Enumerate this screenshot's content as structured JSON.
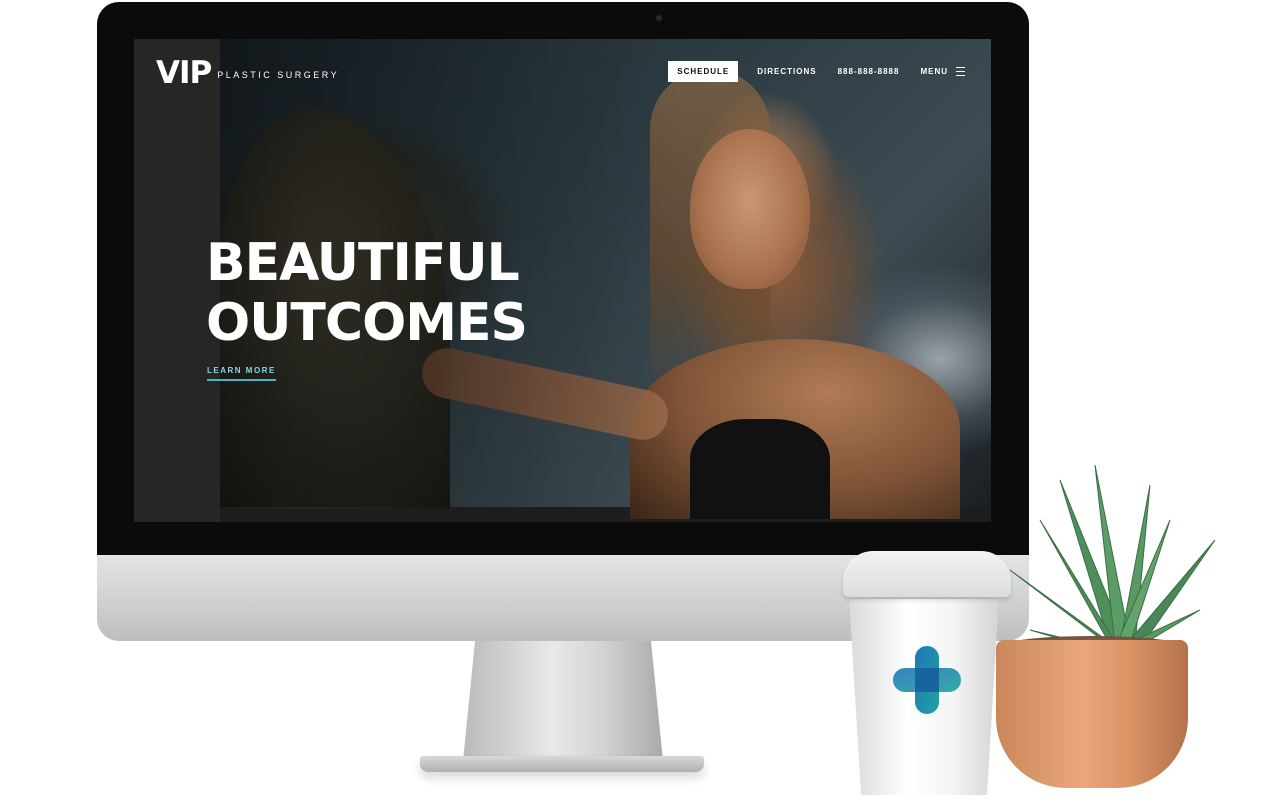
{
  "site": {
    "logo": {
      "mark": "VIP",
      "tagline": "PLASTIC SURGERY"
    },
    "nav": {
      "schedule_label": "SCHEDULE",
      "directions_label": "DIRECTIONS",
      "phone": "888-888-8888",
      "menu_label": "MENU"
    },
    "hero": {
      "headline_line1": "BEAUTIFUL",
      "headline_line2": "OUTCOMES",
      "cta_label": "LEARN MORE"
    }
  },
  "colors": {
    "accent": "#4fb3c8",
    "brand_blue": "#1f76b5",
    "brand_teal": "#1fa3a3",
    "pot": "#e59e70",
    "plant_green": "#4f8f5a"
  },
  "icons": {
    "menu": "hamburger-icon",
    "cup_logo": "medical-cross-icon"
  }
}
